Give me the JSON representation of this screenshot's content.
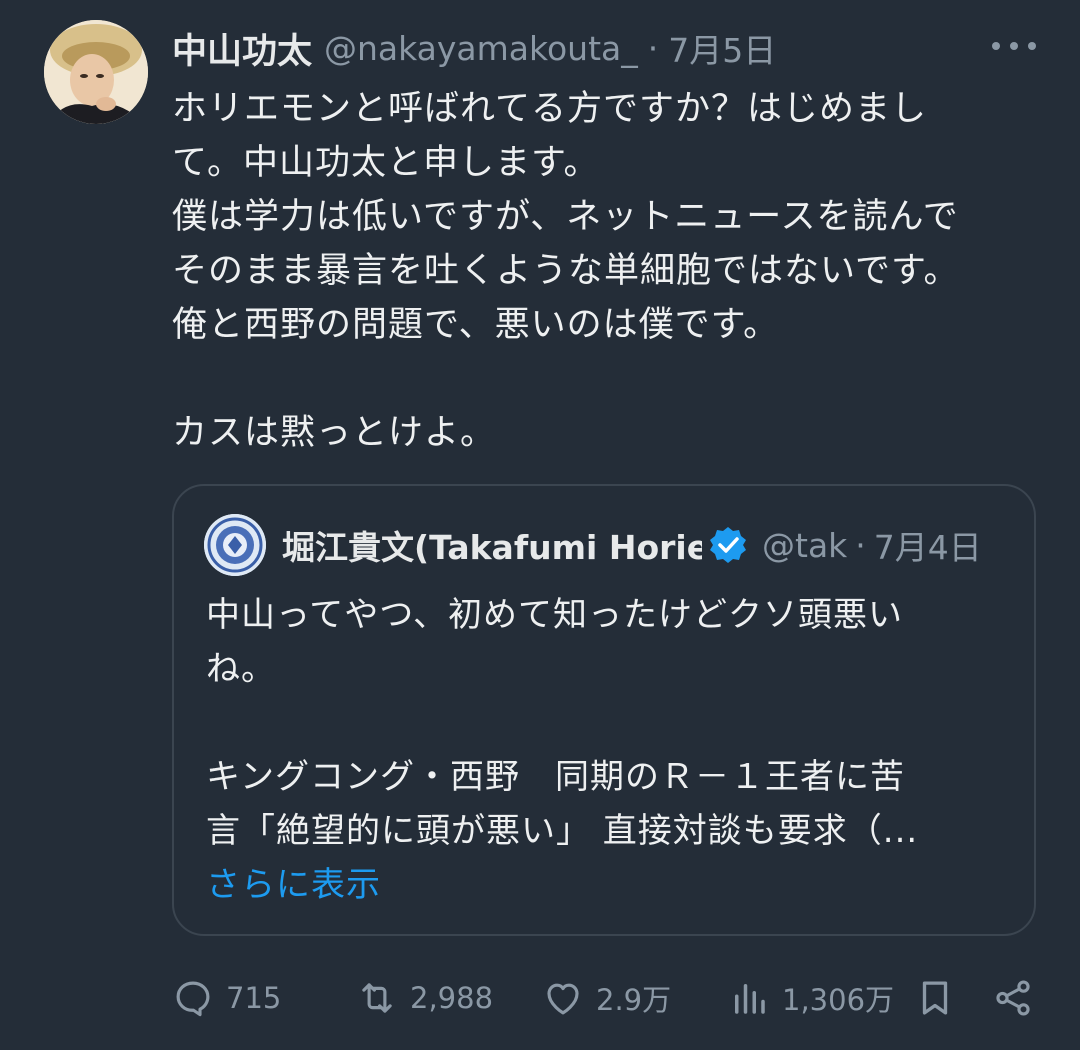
{
  "author": {
    "name": "中山功太",
    "handle": "@nakayamakouta_",
    "separator": "·",
    "date": "7月5日"
  },
  "tweet": {
    "lines": [
      "ホリエモンと呼ばれてる方ですか？はじめまし",
      "て。中山功太と申します。",
      "僕は学力は低いですが、ネットニュースを読んで",
      "そのまま暴言を吐くような単細胞ではないです。",
      "俺と西野の問題で、悪いのは僕です。",
      "",
      "カスは黙っとけよ。"
    ]
  },
  "quoted": {
    "name": "堀江貴文(Takafumi Horie",
    "handle": "@tak",
    "separator": "·",
    "date": "7月4日",
    "lines": [
      "中山ってやつ、初めて知ったけどクソ頭悪い",
      "ね。",
      "",
      "キングコング・西野　同期のＲ－１王者に苦",
      "言「絶望的に頭が悪い」 直接対談も要求（..."
    ],
    "show_more": "さらに表示"
  },
  "actions": {
    "replies": "715",
    "retweets": "2,988",
    "likes": "2.9万",
    "views": "1,306万"
  },
  "colors": {
    "background": "#242d38",
    "text": "#e7e9ea",
    "secondary": "#8b98a5",
    "accent": "#1d9bf0"
  },
  "icons": {
    "more": "more-dots-icon",
    "reply": "reply-icon",
    "retweet": "retweet-icon",
    "like": "heart-icon",
    "views": "views-icon",
    "bookmark": "bookmark-icon",
    "share": "share-icon",
    "verified": "verified-badge-icon"
  }
}
